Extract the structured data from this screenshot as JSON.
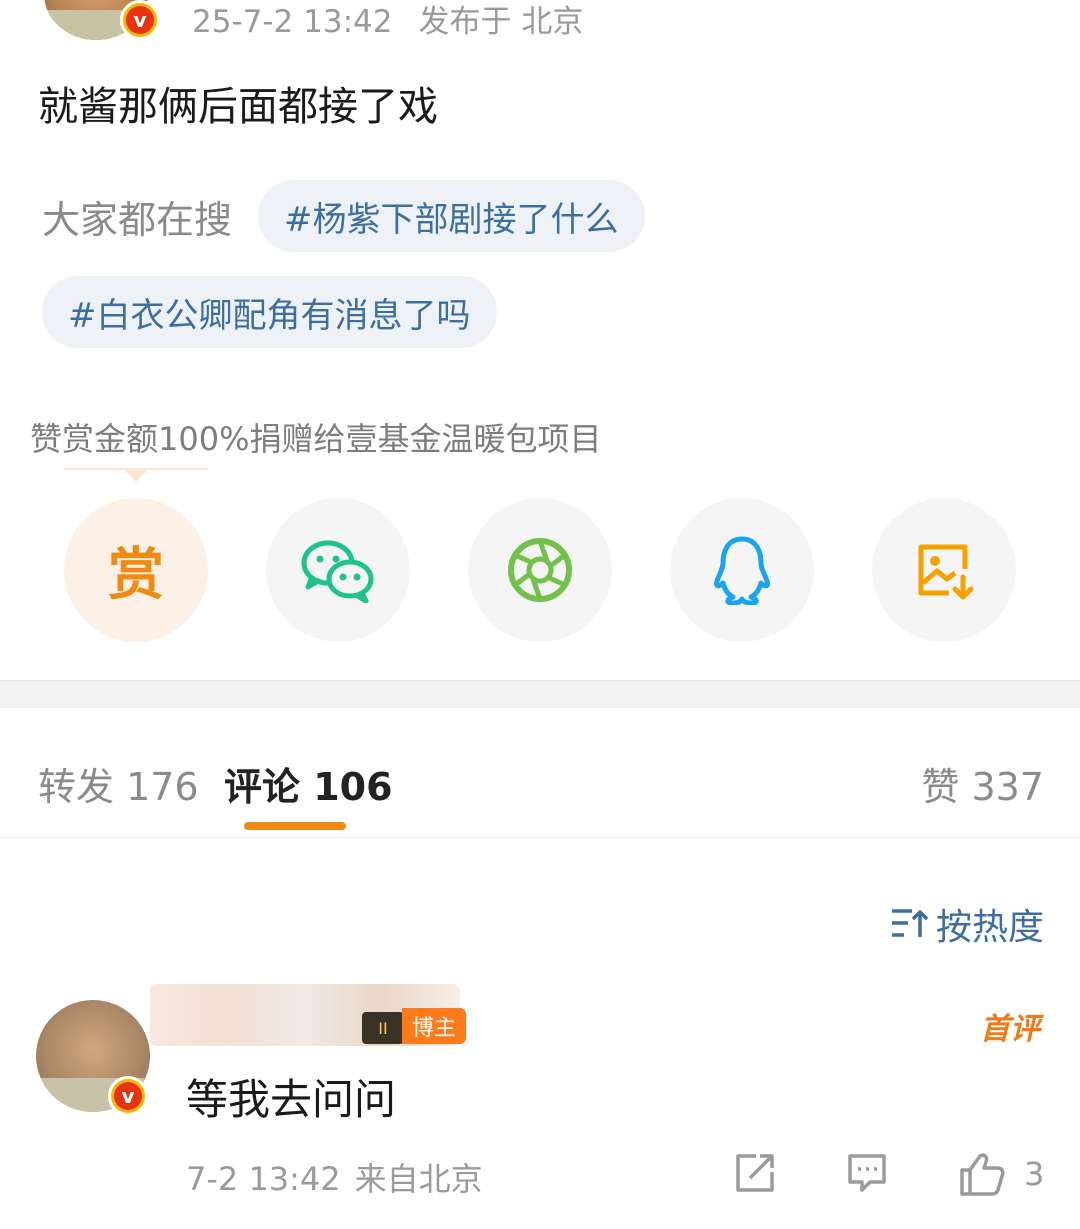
{
  "post": {
    "timestamp": "25-7-2 13:42",
    "location": "发布于 北京",
    "text": "就酱那俩后面都接了戏",
    "search_label": "大家都在搜",
    "search_chips": [
      "#杨紫下部剧接了什么",
      "#白衣公卿配角有消息了吗"
    ],
    "reward_note": "赞赏金额100%捐赠给壹基金温暖包项目"
  },
  "share": {
    "reward_label": "赏",
    "icons": [
      "reward-icon",
      "wechat-icon",
      "moments-icon",
      "qq-icon",
      "save-image-icon"
    ]
  },
  "tabs": {
    "repost": "转发 176",
    "comment": "评论 106",
    "like": "赞 337"
  },
  "sort": {
    "label": "按热度"
  },
  "comment": {
    "badge_label": "博主",
    "rank_label": "II",
    "first_tag": "首评",
    "text": "等我去问问",
    "time": "7-2 13:42",
    "source": "来自北京",
    "like_count": "3"
  },
  "colors": {
    "accent": "#f08a12",
    "link": "#3c6e9f",
    "wechat": "#1fc28b",
    "qq": "#1aa3f2"
  }
}
